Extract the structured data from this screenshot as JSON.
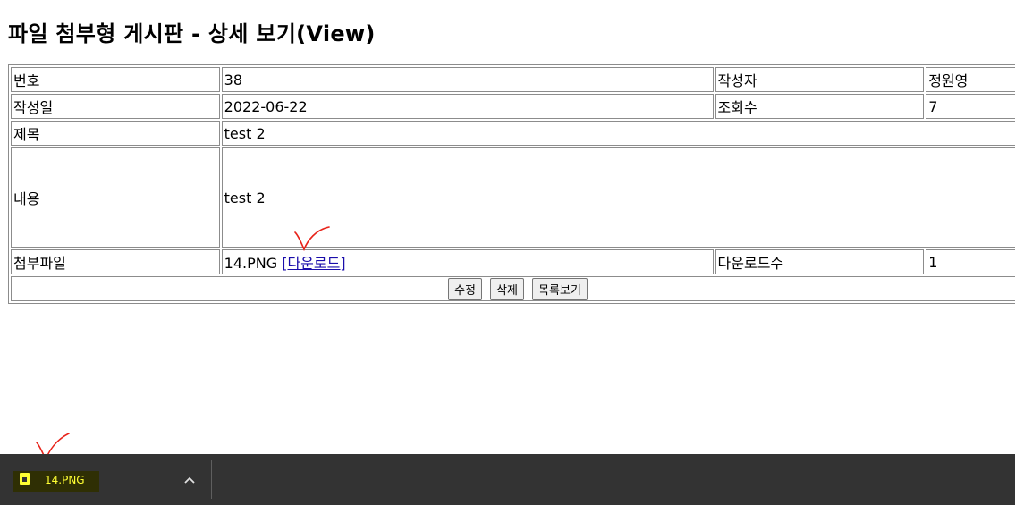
{
  "page": {
    "title": "파일 첨부형 게시판 - 상세 보기(View)"
  },
  "post": {
    "no_label": "번호",
    "no_value": "38",
    "author_label": "작성자",
    "author_value": "정원영",
    "date_label": "작성일",
    "date_value": "2022-06-22",
    "views_label": "조회수",
    "views_value": "7",
    "subject_label": "제목",
    "subject_value": "test 2",
    "content_label": "내용",
    "content_value": "test 2",
    "attach_label": "첨부파일",
    "attach_name": "14.PNG",
    "download_link": "[다운로드]",
    "download_count_label": "다운로드수",
    "download_count_value": "1"
  },
  "buttons": {
    "edit": "수정",
    "delete": "삭제",
    "list": "목록보기"
  },
  "download_shelf": {
    "file_name": "14.PNG",
    "chevron_icon": "chevron-up-icon",
    "file_icon": "image-file-icon",
    "highlight_color": "#ffff33"
  },
  "annotations": {
    "color": "#e8231a"
  }
}
